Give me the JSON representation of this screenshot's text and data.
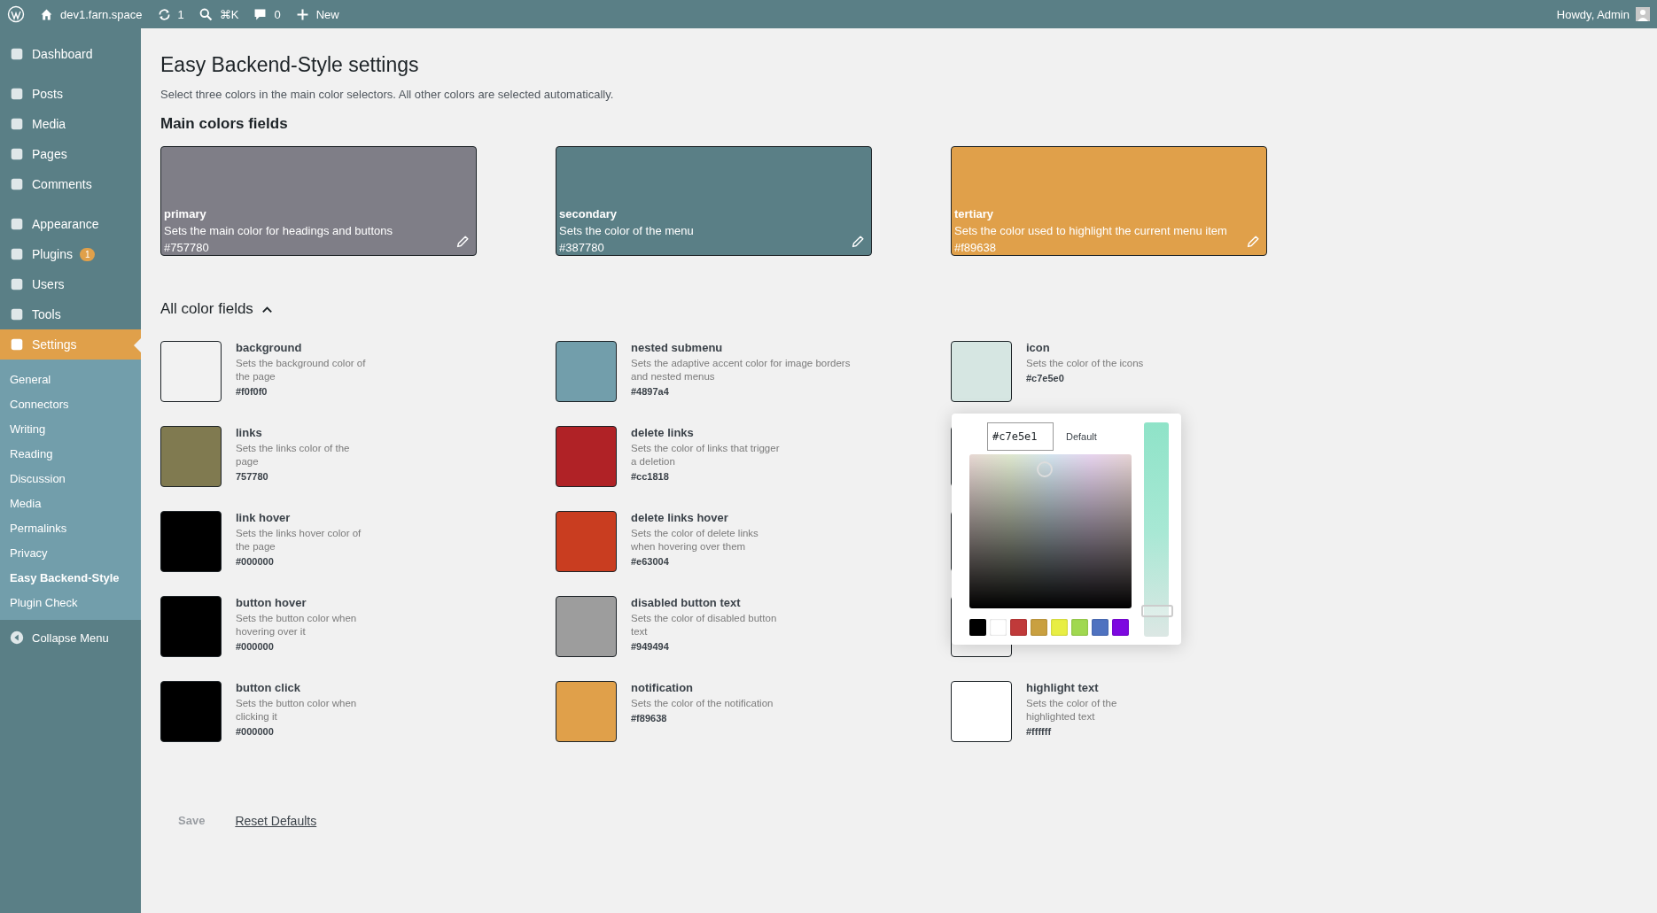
{
  "admin_bar": {
    "site": "dev1.farn.space",
    "updates": "1",
    "search_shortcut": "⌘K",
    "comments": "0",
    "new": "New",
    "greeting": "Howdy, Admin"
  },
  "sidebar": {
    "items": [
      {
        "label": "Dashboard",
        "selected": false
      },
      {
        "label": "Posts",
        "selected": false
      },
      {
        "label": "Media",
        "selected": false
      },
      {
        "label": "Pages",
        "selected": false
      },
      {
        "label": "Comments",
        "selected": false
      },
      {
        "label": "Appearance",
        "selected": false
      },
      {
        "label": "Plugins",
        "selected": false,
        "badge": "1"
      },
      {
        "label": "Users",
        "selected": false
      },
      {
        "label": "Tools",
        "selected": false
      },
      {
        "label": "Settings",
        "selected": true
      }
    ],
    "submenu": [
      {
        "label": "General",
        "selected": false
      },
      {
        "label": "Connectors",
        "selected": false
      },
      {
        "label": "Writing",
        "selected": false
      },
      {
        "label": "Reading",
        "selected": false
      },
      {
        "label": "Discussion",
        "selected": false
      },
      {
        "label": "Media",
        "selected": false
      },
      {
        "label": "Permalinks",
        "selected": false
      },
      {
        "label": "Privacy",
        "selected": false
      },
      {
        "label": "Easy Backend-Style",
        "selected": true
      },
      {
        "label": "Plugin Check",
        "selected": false
      }
    ],
    "collapse": "Collapse Menu"
  },
  "page": {
    "title": "Easy Backend-Style settings",
    "intro": "Select three colors in the main color selectors. All other colors are selected automatically.",
    "main_heading": "Main colors fields",
    "main_colors": [
      {
        "label": "primary",
        "description": "Sets the main color for headings and buttons",
        "value": "#757780",
        "color": "#7f7e87"
      },
      {
        "label": "secondary",
        "description": "Sets the color of the menu",
        "value": "#387780",
        "color": "#5a7f86"
      },
      {
        "label": "tertiary",
        "description": "Sets the color used to highlight the current menu item",
        "value": "#f89638",
        "color": "#e0a04a"
      }
    ],
    "all_heading": "All color fields",
    "all_expanded": true,
    "color_columns": [
      [
        {
          "label": "background",
          "description": "Sets the background color of the page",
          "value": "#f0f0f0",
          "color": "#f2f2f2"
        },
        {
          "label": "links",
          "description": "Sets the links color of the page",
          "value": "757780",
          "color": "#807a50"
        },
        {
          "label": "link hover",
          "description": "Sets the links hover color of the page",
          "value": "#000000",
          "color": "#000000"
        },
        {
          "label": "button hover",
          "description": "Sets the button color when hovering over it",
          "value": "#000000",
          "color": "#000000"
        },
        {
          "label": "button click",
          "description": "Sets the button color when clicking it",
          "value": "#000000",
          "color": "#000000"
        }
      ],
      [
        {
          "label": "nested submenu",
          "description": "Sets the adaptive accent color for image borders and nested menus",
          "value": "#4897a4",
          "color": "#729eab"
        },
        {
          "label": "delete links",
          "description": "Sets the color of links that trigger a deletion",
          "value": "#cc1818",
          "color": "#b02226"
        },
        {
          "label": "delete links hover",
          "description": "Sets the color of delete links when hovering over them",
          "value": "#e63004",
          "color": "#c93d20"
        },
        {
          "label": "disabled button text",
          "description": "Sets the color of disabled button text",
          "value": "#949494",
          "color": "#9d9d9d"
        },
        {
          "label": "notification",
          "description": "Sets the color of the notification",
          "value": "#f89638",
          "color": "#e0a04a"
        }
      ],
      [
        {
          "label": "icon",
          "description": "Sets the color of the icons",
          "value": "#c7e5e0",
          "color": "#d6e6e2"
        },
        {
          "covered": true,
          "color": "#f2f2f2"
        },
        {
          "covered": true,
          "color": "#f2f2f2"
        },
        {
          "covered": true,
          "color": "#f2f2f2"
        },
        {
          "label": "highlight text",
          "description": "Sets the color of the highlighted text",
          "value": "#ffffff",
          "color": "#ffffff"
        }
      ]
    ]
  },
  "picker": {
    "hex": "#c7e5e1",
    "default_label": "Default",
    "palette": [
      {
        "color": "#000000"
      },
      {
        "color": "#ffffff"
      },
      {
        "color": "#c03a3a"
      },
      {
        "color": "#c9a040"
      },
      {
        "color": "#e8ee44"
      },
      {
        "color": "#a0d850"
      },
      {
        "color": "#4f72c0"
      },
      {
        "color": "#7d08e0"
      }
    ],
    "hue": {
      "level": 0.12
    }
  },
  "footer": {
    "save": {
      "label": "Save",
      "disabled": true
    },
    "reset": "Reset Defaults"
  }
}
